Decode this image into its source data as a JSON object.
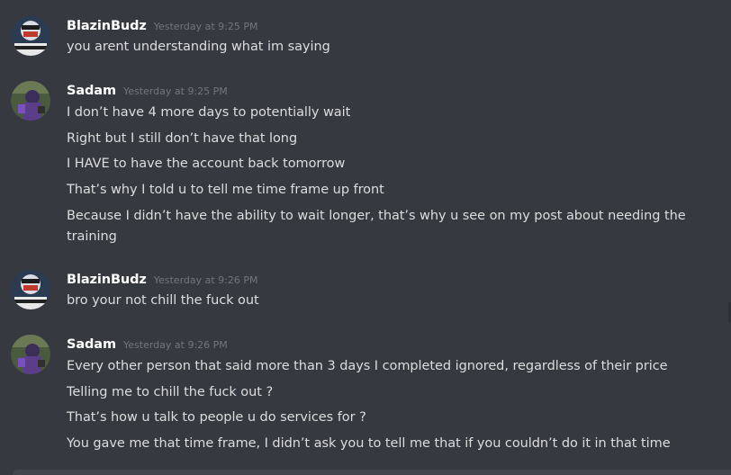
{
  "users": {
    "blazin": {
      "name": "BlazinBudz",
      "avatar_icon": "blazinbudz-avatar-icon"
    },
    "sadam": {
      "name": "Sadam",
      "avatar_icon": "sadam-avatar-icon"
    }
  },
  "messages": [
    {
      "author": "BlazinBudz",
      "timestamp": "Yesterday at 9:25 PM",
      "lines": [
        "you arent understanding what im saying"
      ]
    },
    {
      "author": "Sadam",
      "timestamp": "Yesterday at 9:25 PM",
      "lines": [
        "I don’t have 4 more days to potentially wait",
        "Right but I still don’t have that long",
        "I HAVE to have the account back tomorrow",
        "That’s why I told u to tell me time frame up front",
        "Because I didn’t have the ability to wait longer, that’s why u see on my post about needing the training"
      ]
    },
    {
      "author": "BlazinBudz",
      "timestamp": "Yesterday at 9:26 PM",
      "lines": [
        "bro your not chill the fuck out"
      ]
    },
    {
      "author": "Sadam",
      "timestamp": "Yesterday at 9:26 PM",
      "lines": [
        "Every other person that said more than 3 days I completed ignored, regardless of their price",
        "Telling me to chill the fuck out ?",
        "That’s how u talk to people u do services for ?",
        "You gave me that time frame, I didn’t ask you to tell me that if you couldn’t do it in that time"
      ]
    }
  ],
  "colors": {
    "background": "#36393f",
    "username": "#ffffff",
    "message_text": "#dcddde",
    "timestamp": "#72767d"
  }
}
